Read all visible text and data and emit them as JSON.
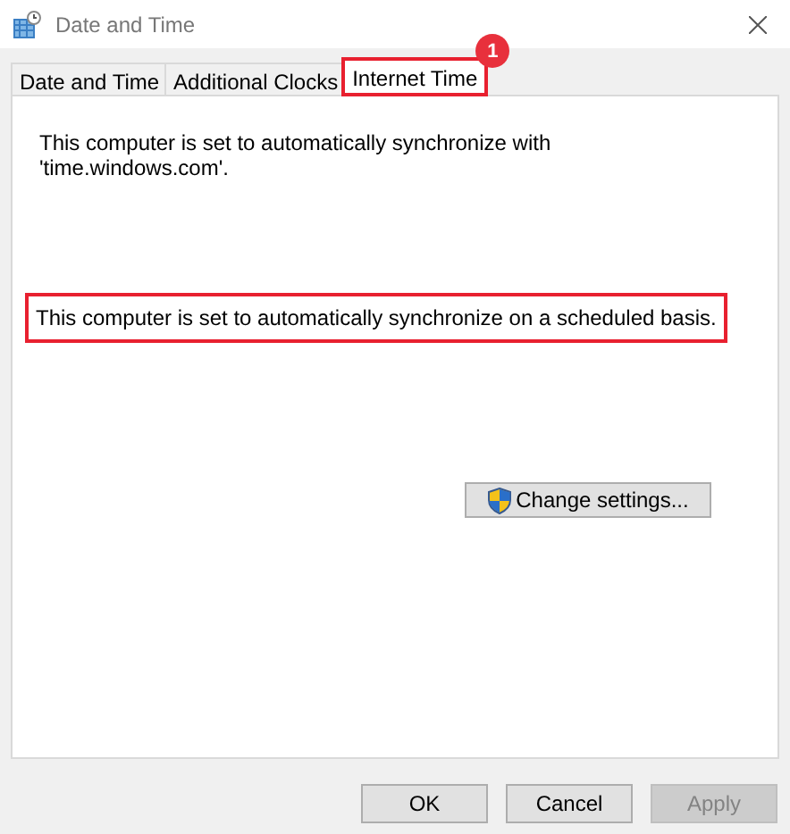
{
  "window": {
    "title": "Date and Time"
  },
  "tabs": [
    {
      "label": "Date and Time",
      "selected": false,
      "highlighted": false
    },
    {
      "label": "Additional Clocks",
      "selected": false,
      "highlighted": false
    },
    {
      "label": "Internet Time",
      "selected": true,
      "highlighted": true,
      "badge": "1"
    }
  ],
  "messages": [
    {
      "text": "This computer is set to automatically synchronize with 'time.windows.com'.",
      "highlighted": false
    },
    {
      "text": "This computer is set to automatically synchronize on a scheduled basis.",
      "highlighted": true
    }
  ],
  "change_button": {
    "label": "Change settings..."
  },
  "buttons": [
    {
      "label": "OK",
      "disabled": false
    },
    {
      "label": "Cancel",
      "disabled": false
    },
    {
      "label": "Apply",
      "disabled": true
    }
  ]
}
